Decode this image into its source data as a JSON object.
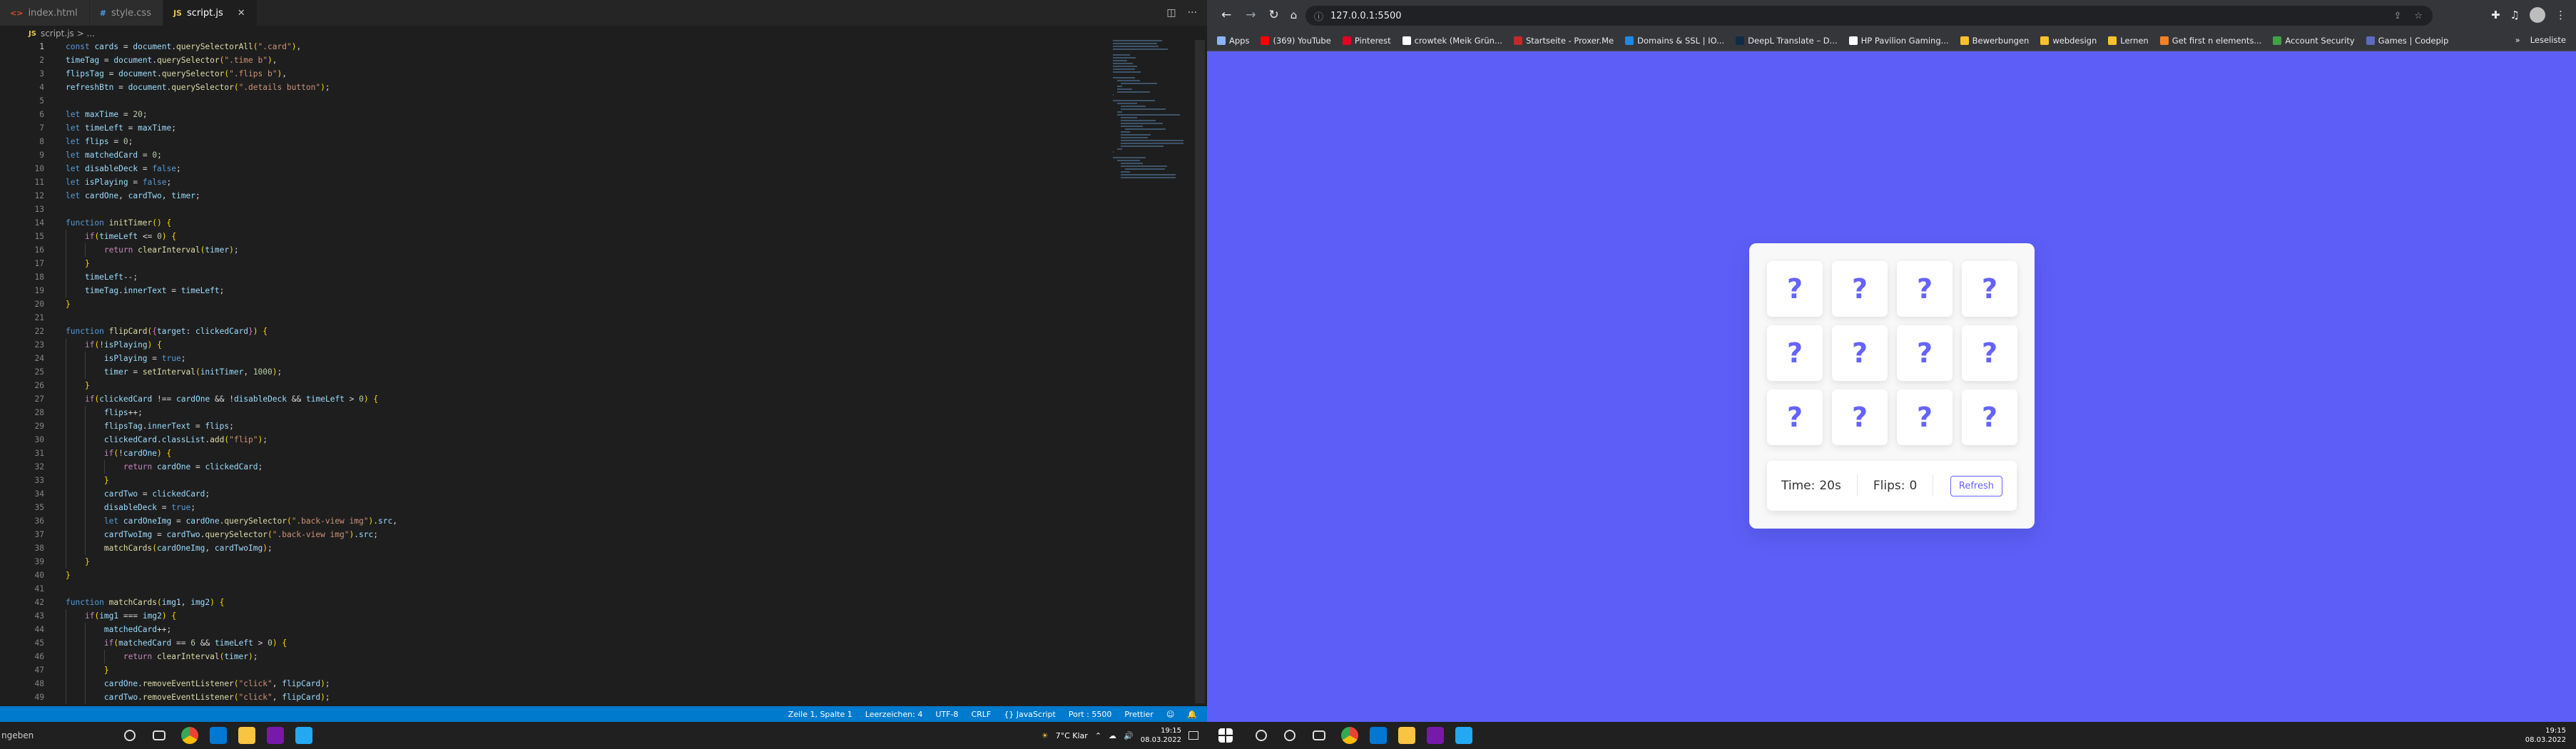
{
  "vscode": {
    "tabs": [
      {
        "label": "index.html",
        "icon": "html-file-icon",
        "color": "#e44d26"
      },
      {
        "label": "style.css",
        "icon": "css-file-icon",
        "color": "#42a5f5"
      },
      {
        "label": "script.js",
        "icon": "js-file-icon",
        "color": "#e8c44c",
        "active": true
      }
    ],
    "breadcrumb": "script.js > ...",
    "line_count": 49,
    "current_line": 1,
    "code": [
      "const cards = document.querySelectorAll(\".card\"),",
      "timeTag = document.querySelector(\".time b\"),",
      "flipsTag = document.querySelector(\".flips b\"),",
      "refreshBtn = document.querySelector(\".details button\");",
      "",
      "let maxTime = 20;",
      "let timeLeft = maxTime;",
      "let flips = 0;",
      "let matchedCard = 0;",
      "let disableDeck = false;",
      "let isPlaying = false;",
      "let cardOne, cardTwo, timer;",
      "",
      "function initTimer() {",
      "    if(timeLeft <= 0) {",
      "        return clearInterval(timer);",
      "    }",
      "    timeLeft--;",
      "    timeTag.innerText = timeLeft;",
      "}",
      "",
      "function flipCard({target: clickedCard}) {",
      "    if(!isPlaying) {",
      "        isPlaying = true;",
      "        timer = setInterval(initTimer, 1000);",
      "    }",
      "    if(clickedCard !== cardOne && !disableDeck && timeLeft > 0) {",
      "        flips++;",
      "        flipsTag.innerText = flips;",
      "        clickedCard.classList.add(\"flip\");",
      "        if(!cardOne) {",
      "            return cardOne = clickedCard;",
      "        }",
      "        cardTwo = clickedCard;",
      "        disableDeck = true;",
      "        let cardOneImg = cardOne.querySelector(\".back-view img\").src,",
      "        cardTwoImg = cardTwo.querySelector(\".back-view img\").src;",
      "        matchCards(cardOneImg, cardTwoImg);",
      "    }",
      "}",
      "",
      "function matchCards(img1, img2) {",
      "    if(img1 === img2) {",
      "        matchedCard++;",
      "        if(matchedCard == 6 && timeLeft > 0) {",
      "            return clearInterval(timer);",
      "        }",
      "        cardOne.removeEventListener(\"click\", flipCard);",
      "        cardTwo.removeEventListener(\"click\", flipCard);"
    ],
    "status": [
      "Zeile 1, Spalte 1",
      "Leerzeichen: 4",
      "UTF-8",
      "CRLF",
      "{} JavaScript",
      "Port : 5500",
      "Prettier"
    ],
    "search_placeholder": "ngeben",
    "taskbar": {
      "weather": "7°C  Klar",
      "time": "19:15",
      "date": "08.03.2022"
    }
  },
  "browser": {
    "url": "127.0.0.1:5500",
    "bookmarks": [
      {
        "label": "Apps",
        "color": "#8ab4f8"
      },
      {
        "label": "(369) YouTube",
        "color": "#ff0000"
      },
      {
        "label": "Pinterest",
        "color": "#e60023"
      },
      {
        "label": "crowtek (Meik Grün...",
        "color": "#ffffff"
      },
      {
        "label": "Startseite - Proxer.Me",
        "color": "#c62828"
      },
      {
        "label": "Domains & SSL | IO...",
        "color": "#1e88e5"
      },
      {
        "label": "DeepL Translate – D...",
        "color": "#0f2b46"
      },
      {
        "label": "HP Pavilion Gaming...",
        "color": "#ffffff"
      },
      {
        "label": "Bewerbungen",
        "color": "#fbc02d"
      },
      {
        "label": "webdesign",
        "color": "#fbc02d"
      },
      {
        "label": "Lernen",
        "color": "#fbc02d"
      },
      {
        "label": "Get first n elements...",
        "color": "#f48024"
      },
      {
        "label": "Account Security",
        "color": "#43a047"
      },
      {
        "label": "Games | Codepip",
        "color": "#5c6bc0"
      }
    ],
    "reading_list": "Leseliste",
    "game": {
      "cards": [
        "?",
        "?",
        "?",
        "?",
        "?",
        "?",
        "?",
        "?",
        "?",
        "?",
        "?",
        "?"
      ],
      "time_label": "Time:",
      "time_value": "20s",
      "flips_label": "Flips:",
      "flips_value": "0",
      "refresh_label": "Refresh"
    },
    "taskbar": {
      "time": "19:15",
      "date": "08.03.2022"
    },
    "accent": "#6563ff",
    "background": "#5c5ef7"
  }
}
